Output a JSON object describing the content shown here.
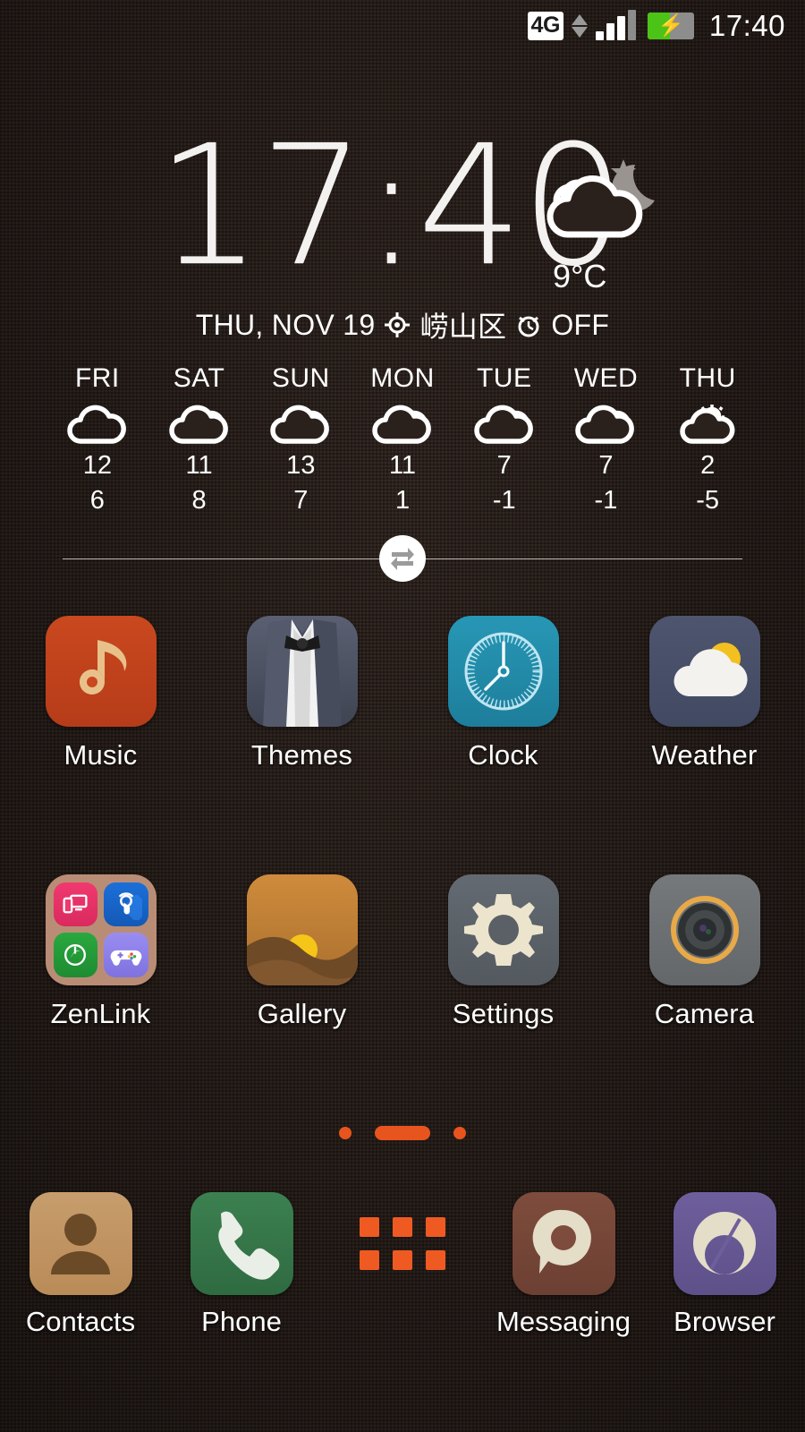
{
  "statusbar": {
    "network": "4G",
    "time": "17:40",
    "icons": {
      "data_arrows": "data-transfer-arrows-icon",
      "signal": "signal-bars-icon",
      "battery": "battery-charging-icon"
    }
  },
  "widget": {
    "clock": "17:40",
    "weather_icon": "night-cloudy-icon",
    "current_temp": "9°C",
    "date": "THU, NOV 19",
    "location": "崂山区",
    "alarm": "OFF",
    "location_icon": "location-crosshair-icon",
    "alarm_icon": "alarm-clock-icon",
    "swap_icon": "swap-arrows-icon"
  },
  "forecast": [
    {
      "day": "FRI",
      "icon": "cloudy-icon",
      "high": "12",
      "low": "6"
    },
    {
      "day": "SAT",
      "icon": "cloudy-icon",
      "high": "11",
      "low": "8"
    },
    {
      "day": "SUN",
      "icon": "cloudy-icon",
      "high": "13",
      "low": "7"
    },
    {
      "day": "MON",
      "icon": "cloudy-icon",
      "high": "11",
      "low": "1"
    },
    {
      "day": "TUE",
      "icon": "cloudy-icon",
      "high": "7",
      "low": "-1"
    },
    {
      "day": "WED",
      "icon": "cloudy-icon",
      "high": "7",
      "low": "-1"
    },
    {
      "day": "THU",
      "icon": "partly-sunny-icon",
      "high": "2",
      "low": "-5"
    }
  ],
  "apps": {
    "row1": [
      {
        "label": "Music",
        "icon": "music-note-icon"
      },
      {
        "label": "Themes",
        "icon": "tuxedo-icon"
      },
      {
        "label": "Clock",
        "icon": "analog-clock-icon"
      },
      {
        "label": "Weather",
        "icon": "sun-cloud-icon"
      }
    ],
    "row2": [
      {
        "label": "ZenLink",
        "icon": "folder-icon"
      },
      {
        "label": "Gallery",
        "icon": "sunset-landscape-icon"
      },
      {
        "label": "Settings",
        "icon": "gear-icon"
      },
      {
        "label": "Camera",
        "icon": "camera-lens-icon"
      }
    ]
  },
  "pages": {
    "count": 3,
    "active_index": 1
  },
  "dock": [
    {
      "label": "Contacts",
      "icon": "person-silhouette-icon"
    },
    {
      "label": "Phone",
      "icon": "phone-handset-icon"
    },
    {
      "label": "",
      "icon": "app-drawer-grid-icon"
    },
    {
      "label": "Messaging",
      "icon": "speech-bubble-icon"
    },
    {
      "label": "Browser",
      "icon": "browser-swirl-icon"
    }
  ],
  "colors": {
    "background": "#2b211c",
    "accent": "#e8541e",
    "text": "#ffffff",
    "music": "#c4441f",
    "clock": "#2189a8",
    "phone": "#37784a",
    "browser": "#6b5b95"
  }
}
